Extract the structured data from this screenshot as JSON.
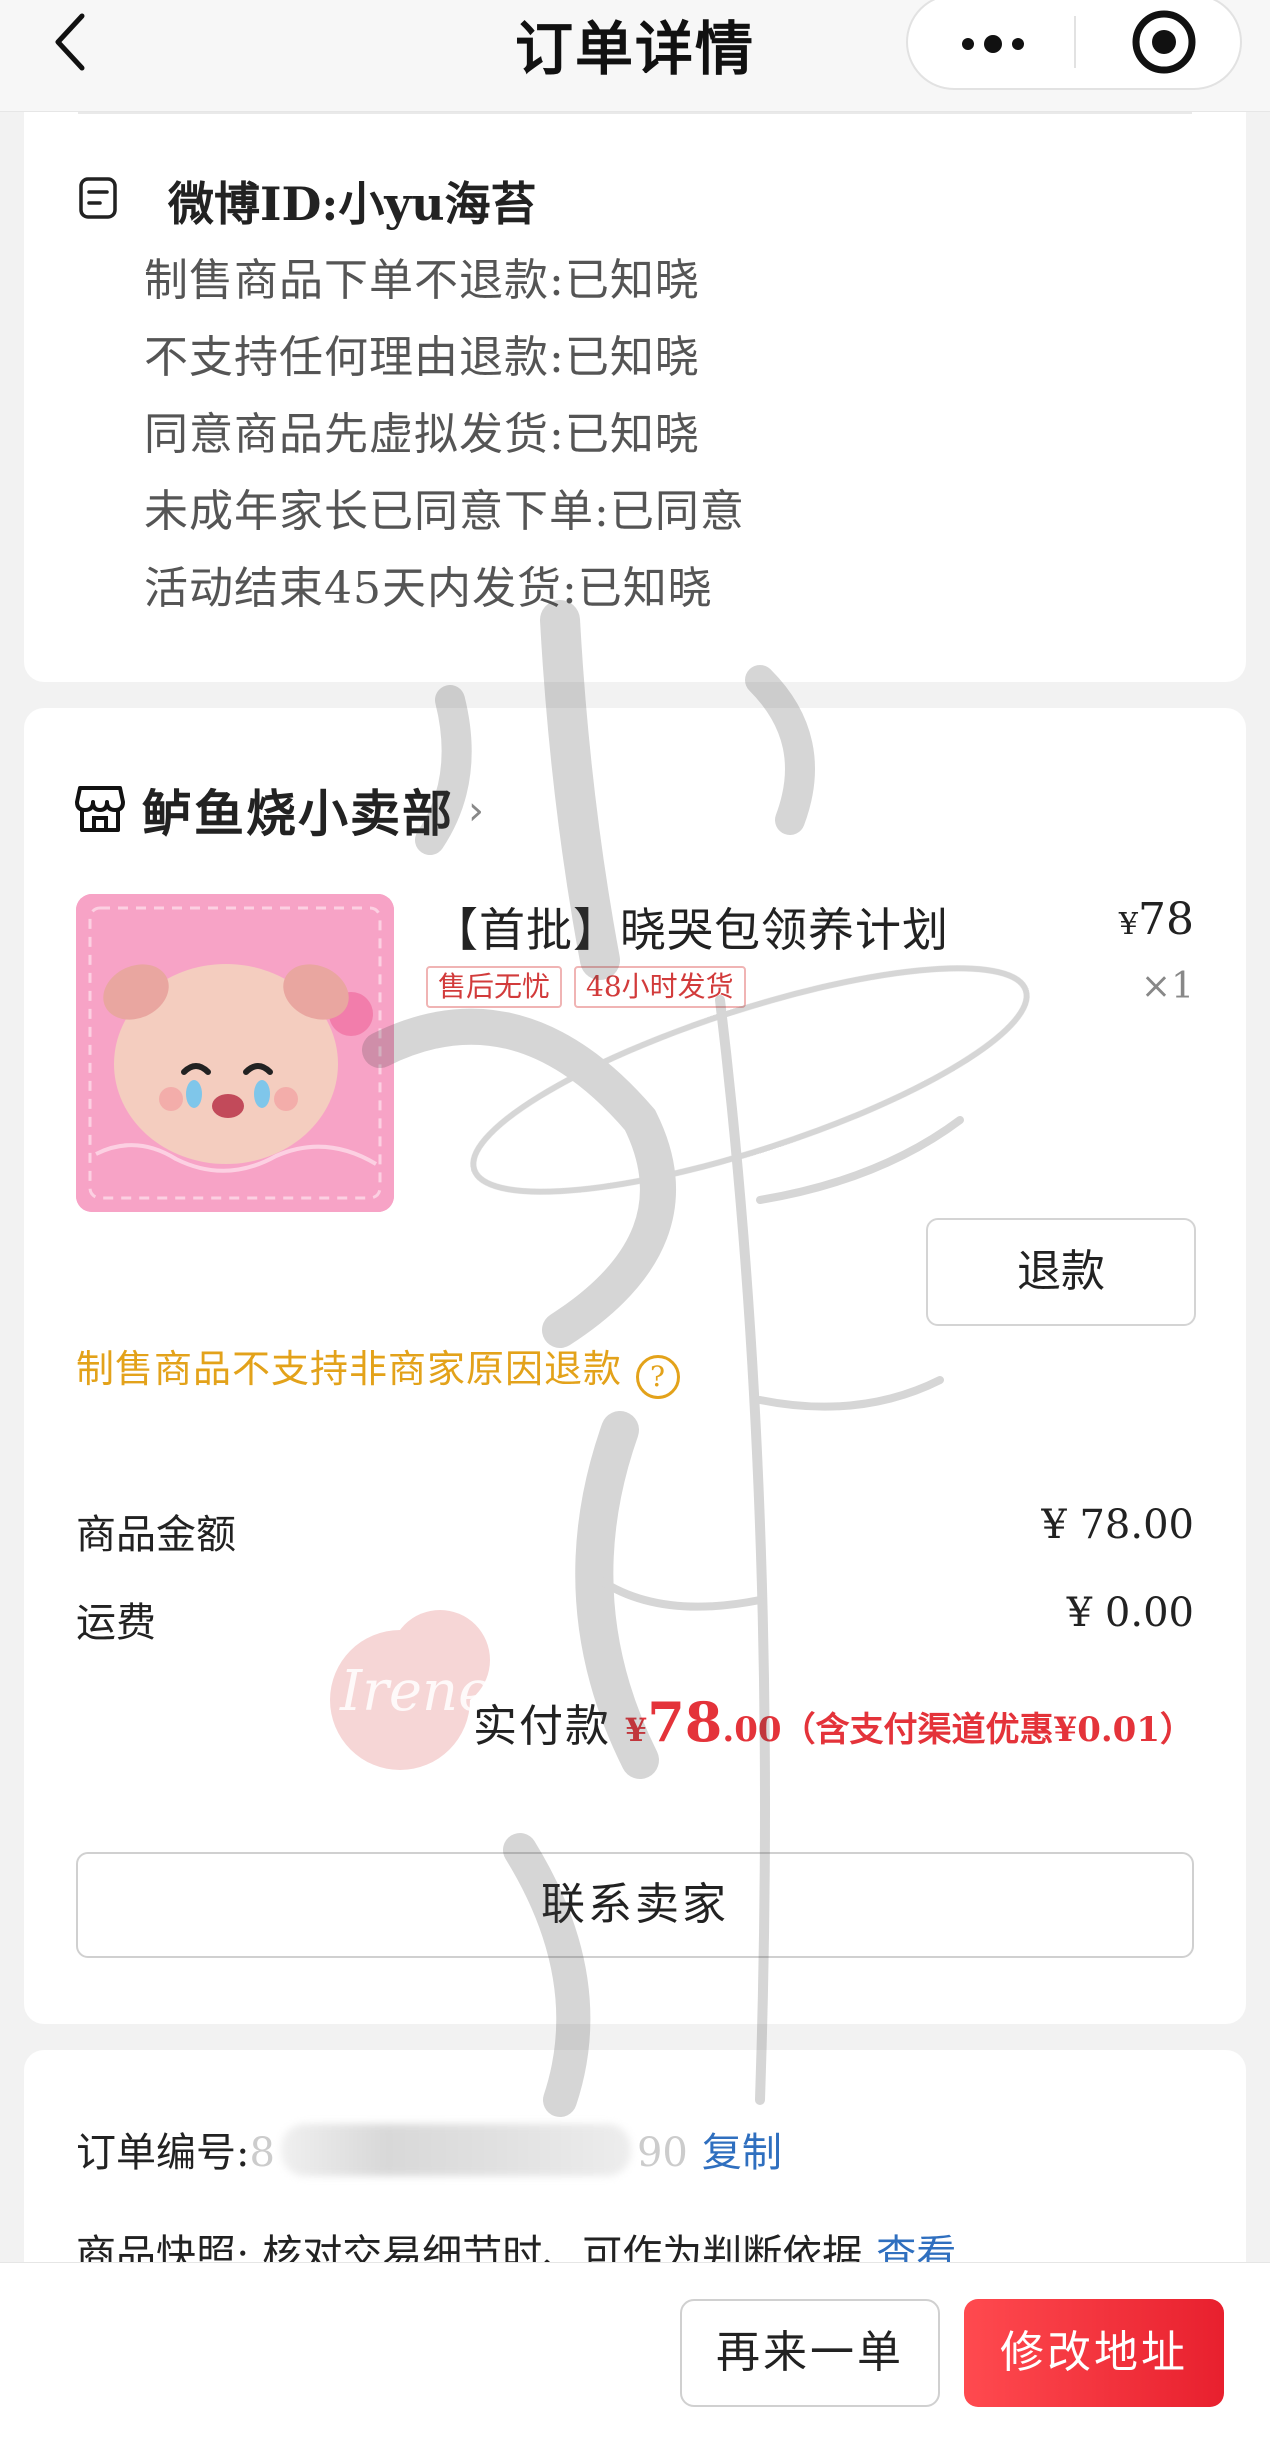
{
  "header": {
    "title": "订单详情",
    "back_icon": "chevron-left-icon",
    "more_icon": "more-dots-icon",
    "target_icon": "target-circle-icon"
  },
  "buyer": {
    "id_line": "微博ID:小yu海苔",
    "remarks": [
      "制售商品下单不退款:已知晓",
      "不支持任何理由退款:已知晓",
      "同意商品先虚拟发货:已知晓",
      "未成年家长已同意下单:已同意",
      "活动结束45天内发货:已知晓"
    ]
  },
  "shop": {
    "name": "鲈鱼烧小卖部",
    "chevron": "›"
  },
  "product": {
    "title": "【首批】晓哭包领养计划",
    "tags": [
      "售后无忧",
      "48小时发货"
    ],
    "price_symbol": "¥",
    "price": "78",
    "quantity": "×1",
    "refund_label": "退款",
    "notice": "制售商品不支持非商家原因退款",
    "notice_icon": "?"
  },
  "fees": {
    "goods_label": "商品金额",
    "goods_value": "¥ 78.00",
    "shipping_label": "运费",
    "shipping_value": "¥ 0.00",
    "paid_label": "实付款",
    "paid_symbol": "¥",
    "paid_int": "78",
    "paid_dec": ".00",
    "paid_discount": "（含支付渠道优惠¥0.01）"
  },
  "contact_label": "联系卖家",
  "order": {
    "number_label": "订单编号:",
    "number_prefix": "8",
    "number_suffix": "90",
    "copy_label": "复制",
    "snapshot_label": "商品快照: 核对交易细节时、可作为判断依据",
    "view_label": "查看"
  },
  "bottom": {
    "again_label": "再来一单",
    "address_label": "修改地址"
  },
  "watermark_text": "Irene",
  "colors": {
    "accent_red": "#e4333a",
    "notice_orange": "#e3a21a",
    "link_blue": "#2f6fbf"
  }
}
